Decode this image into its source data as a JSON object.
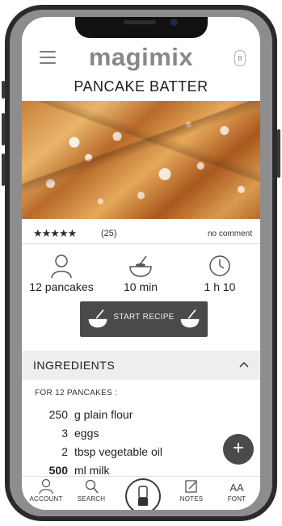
{
  "header": {
    "logo": "magimix",
    "bt_symbol": "ʙ"
  },
  "recipe": {
    "title": "PANCAKE BATTER",
    "rating": {
      "stars": "★★★★★",
      "count": "(25)",
      "comment_text": "no comment"
    },
    "info": {
      "yield": "12 pancakes",
      "prep_time": "10 min",
      "total_time": "1 h 10"
    },
    "start_button_label": "START RECIPE"
  },
  "ingredients": {
    "header": "INGREDIENTS",
    "for_label": "FOR 12 PANCAKES :",
    "items": [
      {
        "qty": "250",
        "name": "g plain flour"
      },
      {
        "qty": "3",
        "name": "eggs"
      },
      {
        "qty": "2",
        "name": "tbsp vegetable oil"
      },
      {
        "qty": "500",
        "name": "ml milk"
      }
    ]
  },
  "fab_symbol": "+",
  "tabbar": {
    "account": "ACCOUNT",
    "search": "SEARCH",
    "notes": "NOTES",
    "font": "FONT",
    "font_glyph": "AA"
  },
  "colors": {
    "dark_button": "#4a4a4a",
    "logo_gray": "#888888",
    "section_bg": "#eeeeee"
  }
}
